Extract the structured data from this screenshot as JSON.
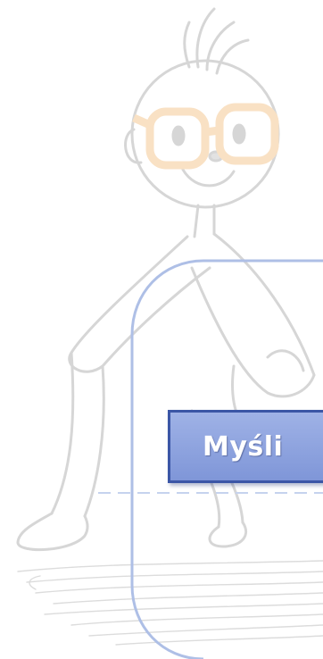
{
  "label": {
    "text": "Myśli"
  },
  "colors": {
    "figure_stroke": "#d6d6d6",
    "glasses": "#f9e1c4",
    "frame_outline": "#aebfe6",
    "frame_dashes": "#c6d3ee",
    "label_fill": "#8aa0dd",
    "label_border": "#3b56a6",
    "label_text": "#ffffff"
  },
  "icons": {
    "figure": "stick-figure-with-glasses-illustration"
  }
}
